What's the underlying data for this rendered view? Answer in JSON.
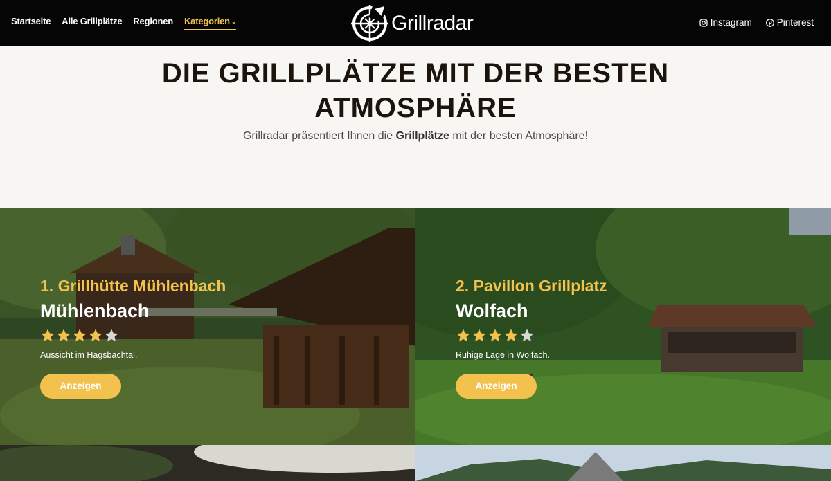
{
  "nav": {
    "items": [
      {
        "label": "Startseite",
        "active": false
      },
      {
        "label": "Alle Grillplätze",
        "active": false
      },
      {
        "label": "Regionen",
        "active": false
      },
      {
        "label": "Kategorien",
        "active": true,
        "has_dropdown": true
      }
    ]
  },
  "logo": {
    "text": "Grillradar",
    "icon": "crosshair-grill-icon"
  },
  "social": {
    "instagram": {
      "label": "Instagram",
      "icon": "instagram-icon"
    },
    "pinterest": {
      "label": "Pinterest",
      "icon": "pinterest-icon"
    }
  },
  "hero": {
    "title_line1": "DIE GRILLPLÄTZE MIT DER BESTEN",
    "title_line2": "ATMOSPHÄRE",
    "subtitle_pre": "Grillradar präsentiert Ihnen die",
    "subtitle_bold": "Grillplätze",
    "subtitle_post": "mit der besten Atmosphäre!"
  },
  "cards": [
    {
      "rank_title": "1. Grillhütte Mühlenbach",
      "place": "Mühlenbach",
      "rating": 4,
      "rating_max": 5,
      "description": "Aussicht im Hagsbachtal.",
      "button": "Anzeigen"
    },
    {
      "rank_title": "2. Pavillon Grillplatz",
      "place": "Wolfach",
      "rating": 4,
      "rating_max": 5,
      "description": "Ruhige Lage in Wolfach.",
      "button": "Anzeigen"
    }
  ],
  "colors": {
    "accent": "#f2c14e",
    "header_bg": "#050505",
    "title": "#1b140c",
    "star_empty": "#d8d8d8"
  }
}
